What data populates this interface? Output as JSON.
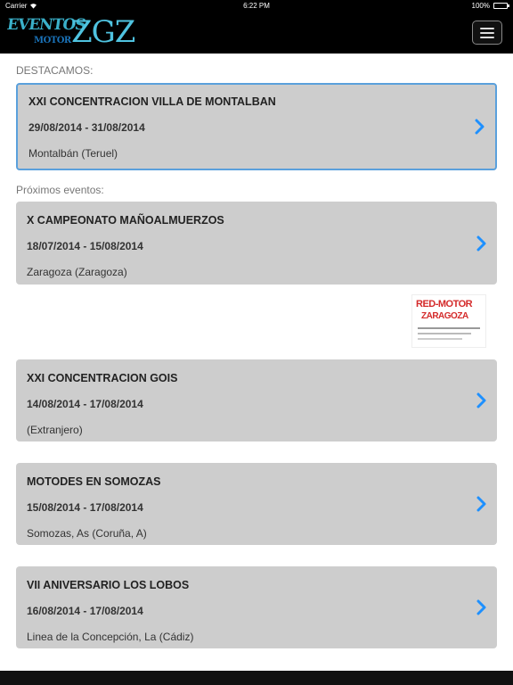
{
  "status_bar": {
    "carrier": "Carrier",
    "time": "6:22 PM",
    "battery": "100%"
  },
  "header": {
    "logo_eventos": "EVENTOS",
    "logo_motor": "MOTOR",
    "logo_zgz": "ZGZ",
    "menu_icon": "hamburger-menu-icon"
  },
  "featured_label": "DESTACAMOS:",
  "featured": {
    "title": "XXI CONCENTRACION VILLA DE MONTALBAN",
    "dates": "29/08/2014 - 31/08/2014",
    "place": "Montalbán (Teruel)"
  },
  "upcoming_label": "Próximos eventos:",
  "events": [
    {
      "title": "X CAMPEONATO MAÑOALMUERZOS",
      "dates": "18/07/2014 - 15/08/2014",
      "place": "Zaragoza (Zaragoza)"
    },
    {
      "title": "XXI CONCENTRACION GOIS",
      "dates": "14/08/2014 - 17/08/2014",
      "place": "(Extranjero)"
    },
    {
      "title": "MOTODES EN SOMOZAS",
      "dates": "15/08/2014 - 17/08/2014",
      "place": "Somozas, As (Coruña, A)"
    },
    {
      "title": "VII ANIVERSARIO LOS LOBOS",
      "dates": "16/08/2014 - 17/08/2014",
      "place": "Linea de la Concepción, La (Cádiz)"
    }
  ],
  "ad": {
    "line1": "RED-MOTOR",
    "line2": "ZARAGOZA"
  },
  "colors": {
    "accent": "#1e90ff",
    "card_bg": "#cdcdcd",
    "featured_border": "#5aa0dc",
    "header_bg": "#000000"
  }
}
